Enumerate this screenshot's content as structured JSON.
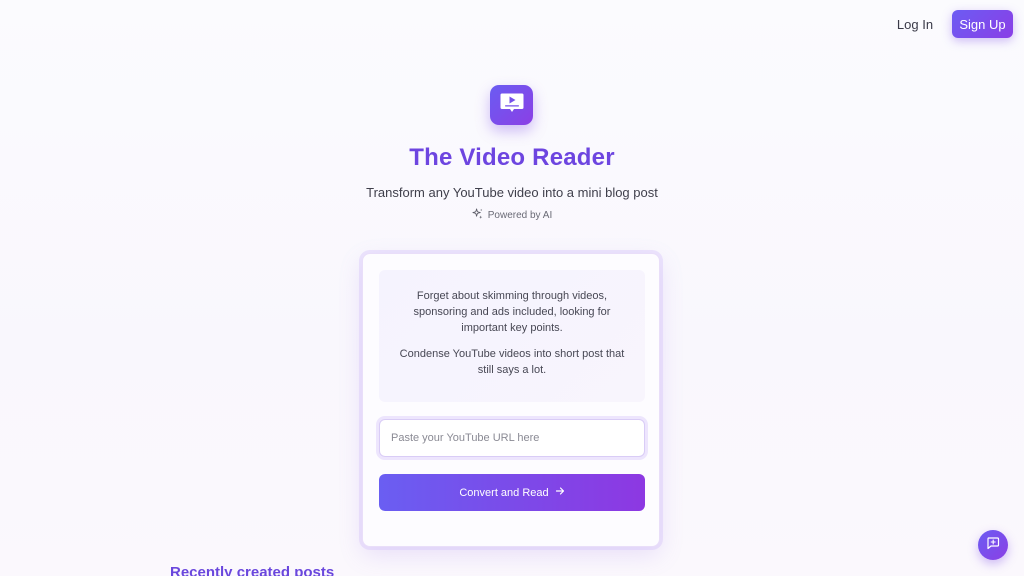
{
  "nav": {
    "login_label": "Log In",
    "signup_label": "Sign Up"
  },
  "hero": {
    "logo_icon": "video-chat-icon",
    "title": "The Video Reader",
    "subtitle": "Transform any YouTube video into a mini blog post",
    "powered_icon": "sparkles-icon",
    "powered_label": "Powered by AI"
  },
  "card": {
    "intro_paragraph_1": "Forget about skimming through videos, sponsoring and ads included, looking for important key points.",
    "intro_paragraph_2": "Condense YouTube videos into short post that still says a lot.",
    "url_input": {
      "placeholder": "Paste your YouTube URL here",
      "value": ""
    },
    "convert_label": "Convert and Read",
    "convert_icon": "arrow-right-icon"
  },
  "recent": {
    "heading": "Recently created posts"
  },
  "chat": {
    "icon": "message-plus-icon"
  },
  "colors": {
    "accent_start": "#6a5cf2",
    "accent_end": "#8b3fe5",
    "title": "#6d45e0"
  }
}
